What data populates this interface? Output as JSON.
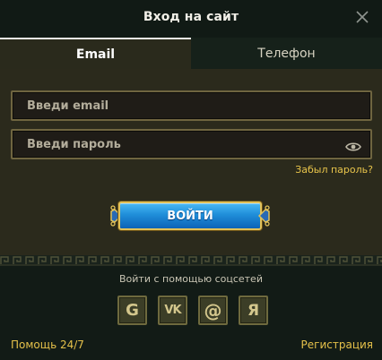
{
  "header": {
    "title": "Вход на сайт",
    "close_icon": "close-icon"
  },
  "tabs": [
    {
      "label": "Email",
      "active": true
    },
    {
      "label": "Телефон",
      "active": false
    }
  ],
  "form": {
    "email_placeholder": "Введи email",
    "email_value": "",
    "password_placeholder": "Введи пароль",
    "password_value": "",
    "eye_icon": "eye-icon",
    "forgot_label": "Забыл пароль?",
    "submit_label": "ВОЙТИ"
  },
  "social": {
    "title": "Войти с помощью соцсетей",
    "buttons": [
      {
        "glyph": "G",
        "icon": "google-icon"
      },
      {
        "glyph": "VK",
        "icon": "vk-icon"
      },
      {
        "glyph": "@",
        "icon": "mail-icon"
      },
      {
        "glyph": "Я",
        "icon": "yandex-icon"
      }
    ]
  },
  "footer": {
    "help_label": "Помощь 24/7",
    "register_label": "Регистрация"
  },
  "colors": {
    "accent_gold": "#e5c14a",
    "button_blue": "#1f8ed9",
    "panel_olive": "#2b2a1c",
    "background": "#121b16"
  }
}
